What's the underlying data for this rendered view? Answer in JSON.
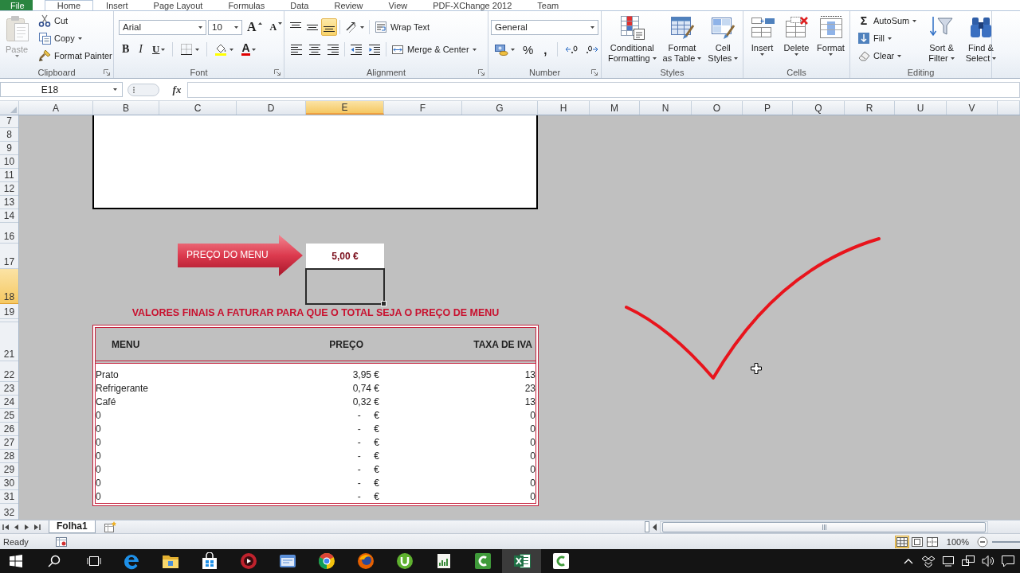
{
  "ribbon_tabs": [
    {
      "label": "File",
      "kind": "file",
      "selected": false
    },
    {
      "label": "Home",
      "kind": "tab",
      "selected": true
    },
    {
      "label": "Insert",
      "kind": "tab",
      "selected": false
    },
    {
      "label": "Page Layout",
      "kind": "tab",
      "selected": false
    },
    {
      "label": "Formulas",
      "kind": "tab",
      "selected": false
    },
    {
      "label": "Data",
      "kind": "tab",
      "selected": false
    },
    {
      "label": "Review",
      "kind": "tab",
      "selected": false
    },
    {
      "label": "View",
      "kind": "tab",
      "selected": false
    },
    {
      "label": "PDF-XChange 2012",
      "kind": "tab",
      "selected": false
    },
    {
      "label": "Team",
      "kind": "tab",
      "selected": false
    }
  ],
  "ribbon_groups": [
    {
      "label": "Clipboard",
      "launcher": true,
      "columns": [
        {
          "kind": "big",
          "lines": [
            "Paste"
          ],
          "dropdown": true,
          "disabled": true
        },
        {
          "kind": "stack",
          "items": [
            {
              "kind": "small",
              "label": "Cut",
              "disabled": false
            },
            {
              "kind": "small",
              "label": "Copy",
              "dropdown": true,
              "disabled": false
            },
            {
              "kind": "small",
              "label": "Format Painter",
              "disabled": false
            }
          ]
        }
      ]
    },
    {
      "label": "Font",
      "launcher": true,
      "columns": [
        {
          "kind": "rows",
          "rows": [
            [
              {
                "kind": "combo",
                "value": "Arial"
              },
              {
                "kind": "combo",
                "value": "10"
              },
              {
                "kind": "glyph",
                "label": "A"
              },
              {
                "kind": "glyph",
                "label": "A"
              }
            ],
            [
              {
                "kind": "glyph",
                "label": "B",
                "on": false
              },
              {
                "kind": "glyph",
                "label": "I",
                "on": false
              },
              {
                "kind": "glyph",
                "label": "U",
                "dropdown": true,
                "on": false
              },
              {
                "kind": "icon",
                "dropdown": true
              },
              {
                "kind": "icon",
                "dropdown": true
              },
              {
                "kind": "glyph",
                "label": "A",
                "dropdown": true
              }
            ]
          ]
        }
      ]
    },
    {
      "label": "Alignment",
      "launcher": true,
      "columns": [
        {
          "kind": "rows",
          "rows": [
            [
              {
                "kind": "icon",
                "on": false
              },
              {
                "kind": "icon",
                "on": false
              },
              {
                "kind": "icon",
                "on": true
              },
              {
                "kind": "icon",
                "dropdown": true,
                "on": false
              },
              {
                "kind": "small",
                "label": "Wrap Text",
                "on": false
              }
            ],
            [
              {
                "kind": "icon",
                "on": false
              },
              {
                "kind": "icon",
                "on": false
              },
              {
                "kind": "icon",
                "on": false
              },
              {
                "kind": "icon",
                "on": false
              },
              {
                "kind": "icon",
                "on": false
              },
              {
                "kind": "small",
                "label": "Merge & Center",
                "dropdown": true,
                "on": false
              }
            ]
          ]
        }
      ]
    },
    {
      "label": "Number",
      "launcher": true,
      "columns": [
        {
          "kind": "rows",
          "rows": [
            [
              {
                "kind": "combo",
                "value": "General"
              }
            ],
            [
              {
                "kind": "icon",
                "dropdown": true
              },
              {
                "kind": "glyph",
                "label": "%"
              },
              {
                "kind": "glyph",
                "label": ","
              },
              {
                "kind": "icon"
              },
              {
                "kind": "icon"
              }
            ]
          ]
        }
      ]
    },
    {
      "label": "Styles",
      "columns": [
        {
          "kind": "big",
          "lines": [
            "Conditional",
            "Formatting"
          ],
          "dropdown": true
        },
        {
          "kind": "big",
          "lines": [
            "Format",
            "as Table"
          ],
          "dropdown": true
        },
        {
          "kind": "big",
          "lines": [
            "Cell",
            "Styles"
          ],
          "dropdown": true
        }
      ]
    },
    {
      "label": "Cells",
      "columns": [
        {
          "kind": "big",
          "lines": [
            "Insert"
          ],
          "dropdown": true
        },
        {
          "kind": "big",
          "lines": [
            "Delete"
          ],
          "dropdown": true
        },
        {
          "kind": "big",
          "lines": [
            "Format"
          ],
          "dropdown": true
        }
      ]
    },
    {
      "label": "Editing",
      "columns": [
        {
          "kind": "stack",
          "items": [
            {
              "kind": "small",
              "symbol": "Σ",
              "label": "AutoSum",
              "dropdown": true
            },
            {
              "kind": "small",
              "label": "Fill",
              "dropdown": true
            },
            {
              "kind": "small",
              "label": "Clear",
              "dropdown": true
            }
          ]
        },
        {
          "kind": "big",
          "lines": [
            "Sort &",
            "Filter"
          ],
          "dropdown": true
        },
        {
          "kind": "big",
          "lines": [
            "Find &",
            "Select"
          ],
          "dropdown": true
        }
      ]
    }
  ],
  "formula_bar": {
    "name_box": "E18",
    "function_button": "fx"
  },
  "columns": [
    {
      "label": "A",
      "selected": false
    },
    {
      "label": "B",
      "selected": false
    },
    {
      "label": "C",
      "selected": false
    },
    {
      "label": "D",
      "selected": false
    },
    {
      "label": "E",
      "selected": true
    },
    {
      "label": "F",
      "selected": false
    },
    {
      "label": "G",
      "selected": false
    },
    {
      "label": "H",
      "selected": false
    },
    {
      "label": "M",
      "selected": false
    },
    {
      "label": "N",
      "selected": false
    },
    {
      "label": "O",
      "selected": false
    },
    {
      "label": "P",
      "selected": false
    },
    {
      "label": "Q",
      "selected": false
    },
    {
      "label": "R",
      "selected": false
    },
    {
      "label": "U",
      "selected": false
    },
    {
      "label": "V",
      "selected": false
    }
  ],
  "rows": [
    {
      "label": "7",
      "selected": false
    },
    {
      "label": "8",
      "selected": false
    },
    {
      "label": "9",
      "selected": false
    },
    {
      "label": "10",
      "selected": false
    },
    {
      "label": "11",
      "selected": false
    },
    {
      "label": "12",
      "selected": false
    },
    {
      "label": "13",
      "selected": false
    },
    {
      "label": "14",
      "selected": false
    },
    {
      "label": "16",
      "selected": false
    },
    {
      "label": "17",
      "selected": false
    },
    {
      "label": "18",
      "selected": true
    },
    {
      "label": "19",
      "selected": false
    },
    {
      "selected": false
    },
    {
      "label": "21",
      "selected": false
    },
    {
      "label": "22",
      "selected": false
    },
    {
      "label": "23",
      "selected": false
    },
    {
      "label": "24",
      "selected": false
    },
    {
      "label": "25",
      "selected": false
    },
    {
      "label": "26",
      "selected": false
    },
    {
      "label": "27",
      "selected": false
    },
    {
      "label": "28",
      "selected": false
    },
    {
      "label": "29",
      "selected": false
    },
    {
      "label": "30",
      "selected": false
    },
    {
      "label": "31",
      "selected": false
    },
    {
      "label": "32",
      "selected": false
    }
  ],
  "sheet": {
    "price_arrow": {
      "label": "PREÇO DO MENU"
    },
    "menu_price": "5,00 €",
    "title": "VALORES FINAIS A FATURAR PARA QUE O TOTAL SEJA O PREÇO DE MENU",
    "table": {
      "columns": [
        "MENU",
        "PREÇO",
        "TAXA DE IVA"
      ],
      "rows": [
        [
          "Prato",
          "3,95 €",
          "13"
        ],
        [
          "Refrigerante",
          "0,74 €",
          "23"
        ],
        [
          "Café",
          "0,32 €",
          "13"
        ],
        [
          "0",
          "-     €",
          "0"
        ],
        [
          "0",
          "-     €",
          "0"
        ],
        [
          "0",
          "-     €",
          "0"
        ],
        [
          "0",
          "-     €",
          "0"
        ],
        [
          "0",
          "-     €",
          "0"
        ],
        [
          "0",
          "-     €",
          "0"
        ],
        [
          "0",
          "-     €",
          "0"
        ]
      ]
    }
  },
  "sheet_tabs": [
    {
      "label": "Folha1",
      "selected": true
    }
  ],
  "status_bar": {
    "status": "Ready",
    "views": [
      {
        "selected": true
      },
      {
        "selected": false
      },
      {
        "selected": false
      }
    ],
    "zoom": "100%"
  },
  "taskbar": {
    "apps": [
      {
        "selected": false
      },
      {
        "selected": false
      },
      {
        "selected": false
      },
      {
        "selected": false
      },
      {
        "selected": false
      },
      {
        "selected": false
      },
      {
        "selected": false
      },
      {
        "selected": false
      },
      {
        "selected": false
      },
      {
        "selected": false
      },
      {
        "selected": true
      },
      {
        "selected": false
      }
    ]
  }
}
